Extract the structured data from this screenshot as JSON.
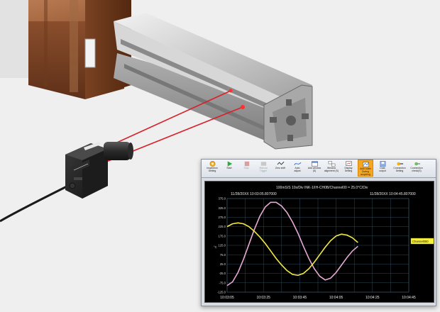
{
  "app": {
    "toolbar": [
      {
        "label": "Inspection\nSetting",
        "icon": "gear-icon",
        "state": "normal"
      },
      {
        "label": "Start",
        "icon": "play-icon",
        "state": "normal"
      },
      {
        "label": "Stop",
        "icon": "stop-icon",
        "state": "disabled"
      },
      {
        "label": "Manual\nTrigger",
        "icon": "trigger-icon",
        "state": "disabled"
      },
      {
        "label": "Zero shift",
        "icon": "zero-icon",
        "state": "normal"
      },
      {
        "label": "Auto\nadjust",
        "icon": "auto-adjust-icon",
        "state": "normal"
      },
      {
        "label": "Add window\n(S)",
        "icon": "add-window-icon",
        "state": "normal"
      },
      {
        "label": "Window\nalignment (S)",
        "icon": "window-align-icon",
        "state": "normal"
      },
      {
        "label": "Display\nSetting",
        "icon": "display-icon",
        "state": "normal"
      },
      {
        "label": "Auto scale\nDuring acquiring",
        "icon": "auto-scale-icon",
        "state": "active"
      },
      {
        "label": "Data\noutput",
        "icon": "data-output-icon",
        "state": "normal"
      },
      {
        "label": "Connection\nSetting",
        "icon": "connection-icon",
        "state": "normal"
      },
      {
        "label": "Connection\ncheck(S)",
        "icon": "connection-check-icon",
        "state": "normal"
      }
    ],
    "screen": {
      "header": "100mS/S    10s/Div    INK-1/IH-CH0B/Channel00 = 25.0°C/Div",
      "start_time": "11/28/20XX 10:03:05.807000",
      "end_time": "11/28/20XX 10:04:45.807000",
      "channel_label": "Channel000",
      "axis_unit": "°C",
      "colors": {
        "grid": "#2e4a5a",
        "plot_bg": "#000000",
        "series_pink": "#e6a9d3",
        "series_yellow": "#f2ea45",
        "channel_box": "#f7f041"
      }
    }
  },
  "chart_data": {
    "type": "line",
    "x_ticks": [
      "10:03:05",
      "10:03:25",
      "10:03:45",
      "10:04:05",
      "10:04:25",
      "10:04:45"
    ],
    "y_ticks": [
      "375.0",
      "325.0",
      "275.0",
      "225.0",
      "175.0",
      "125.0",
      "75.0",
      "25.0",
      "-25.0",
      "-75.0",
      "-125.0"
    ],
    "ylim": [
      -125,
      375
    ],
    "xlim": [
      0,
      100
    ],
    "grid": true,
    "series": [
      {
        "color": "#e6a9d3",
        "x": [
          0,
          3,
          6,
          9,
          12,
          15,
          18,
          21,
          24,
          27,
          30,
          33,
          36,
          39,
          42,
          45,
          48,
          51,
          54,
          57,
          60,
          63,
          66,
          69,
          72
        ],
        "values": [
          -90,
          -70,
          -20,
          50,
          130,
          210,
          280,
          330,
          355,
          355,
          335,
          300,
          250,
          190,
          120,
          55,
          0,
          -40,
          -60,
          -50,
          -20,
          20,
          60,
          95,
          120
        ]
      },
      {
        "color": "#f2ea45",
        "x": [
          0,
          3,
          6,
          9,
          12,
          15,
          18,
          21,
          24,
          27,
          30,
          33,
          36,
          39,
          42,
          45,
          48,
          51,
          54,
          57,
          60,
          63,
          66,
          69,
          72
        ],
        "values": [
          225,
          240,
          245,
          240,
          225,
          200,
          170,
          135,
          95,
          55,
          20,
          -10,
          -30,
          -35,
          -25,
          0,
          35,
          75,
          115,
          150,
          175,
          185,
          180,
          165,
          140
        ]
      }
    ]
  }
}
